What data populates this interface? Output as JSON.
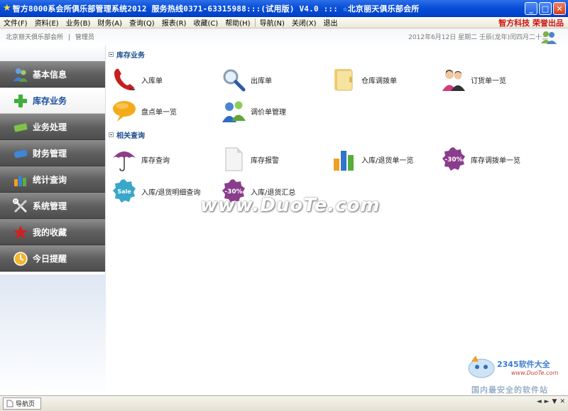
{
  "window": {
    "title": "智方8000系会所俱乐部管理系统2012  服务热线0371-63315988:::(试用版) V4.0  :::  ☆北京丽天俱乐部会所",
    "minimize_label": "_",
    "maximize_label": "□",
    "close_label": "✕"
  },
  "menu": {
    "items": [
      "文件(F)",
      "资料(E)",
      "业务(B)",
      "财务(A)",
      "查询(Q)",
      "报表(R)",
      "收藏(C)",
      "帮助(H)",
      "导航(N)",
      "关闭(X)",
      "退出"
    ],
    "brand": "智方科技  荣誉出品"
  },
  "header": {
    "org": "北京丽天俱乐部会所",
    "separator": "|",
    "role": "管理员",
    "date": "2012年6月12日   星期二   壬辰(龙年)闰四月二十三"
  },
  "sidebar": {
    "items": [
      {
        "label": "基本信息",
        "icon": "people-icon"
      },
      {
        "label": "库存业务",
        "icon": "plus-icon"
      },
      {
        "label": "业务处理",
        "icon": "card-icon"
      },
      {
        "label": "财务管理",
        "icon": "wallet-icon"
      },
      {
        "label": "统计查询",
        "icon": "bar-chart-icon"
      },
      {
        "label": "系统管理",
        "icon": "tools-icon"
      },
      {
        "label": "我的收藏",
        "icon": "star-icon"
      },
      {
        "label": "今日提醒",
        "icon": "clock-icon"
      }
    ]
  },
  "main": {
    "sections": [
      {
        "title": "库存业务",
        "tiles": [
          "入库单",
          "出库单",
          "仓库调拨单",
          "订货单一览",
          "盘点单一览",
          "调价单管理"
        ]
      },
      {
        "title": "相关查询",
        "tiles": [
          "库存查询",
          "库存报警",
          "入库/退货单一览",
          "库存调拨单一览",
          "入库/退货明细查询",
          "入库/退货汇总"
        ]
      }
    ],
    "badge_sale": "Sale",
    "badge_discount": "-30%"
  },
  "watermark": "www.DuoTe.com",
  "logo2345": {
    "name": "2345软件大全",
    "url": "www.DuoTe.com",
    "slogan": "国内最安全的软件站"
  },
  "statusbar": {
    "tab_label": "导航页",
    "nav": [
      "◄",
      "►",
      "▼",
      "✕"
    ]
  },
  "colors": {
    "titlebar": "#0a50d8",
    "brand_red": "#d01010",
    "accent_blue": "#1c4c8f",
    "sidebar_dark": "#5f5f5f"
  }
}
